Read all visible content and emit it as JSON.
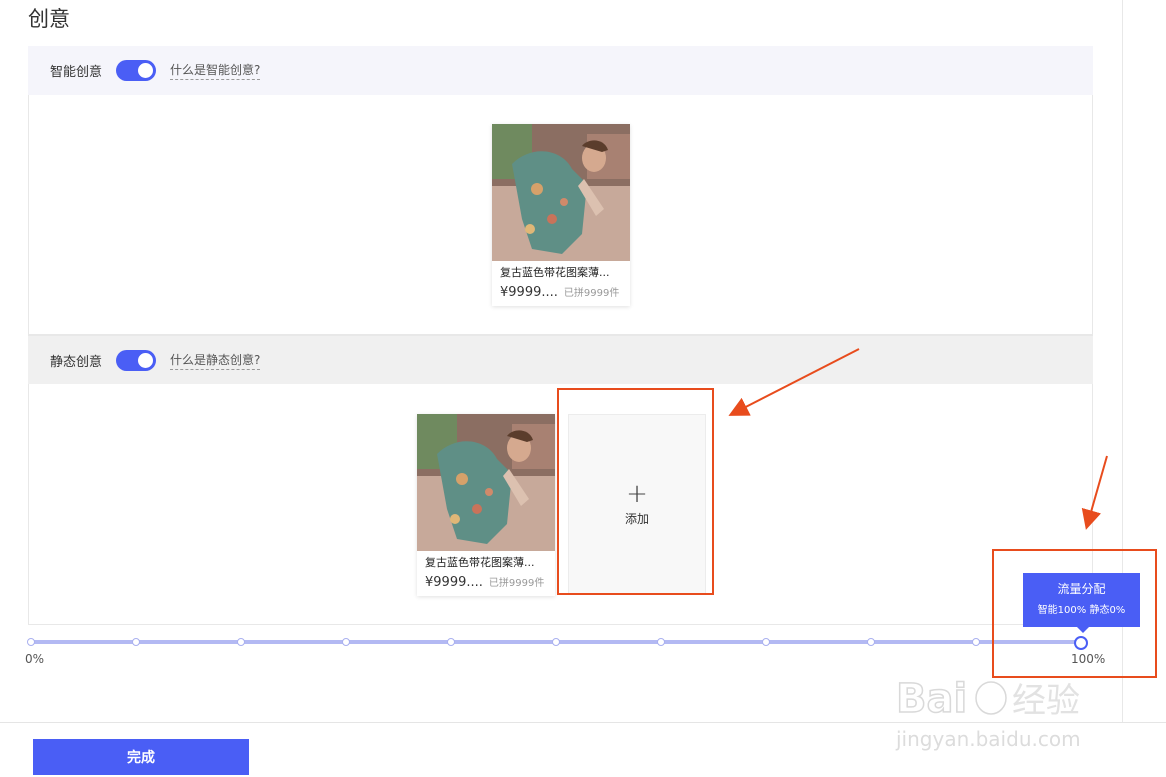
{
  "page": {
    "title": "创意"
  },
  "smart_section": {
    "label": "智能创意",
    "toggle_on": true,
    "help_link": "什么是智能创意?",
    "product": {
      "name": "复古蓝色带花图案薄...",
      "price": "¥9999....",
      "sold": "已拼9999件"
    }
  },
  "static_section": {
    "label": "静态创意",
    "toggle_on": true,
    "help_link": "什么是静态创意?",
    "product": {
      "name": "复古蓝色带花图案薄...",
      "price": "¥9999....",
      "sold": "已拼9999件"
    },
    "add_label": "添加",
    "add_icon": "plus-icon"
  },
  "traffic_slider": {
    "value_percent": 100,
    "min_label": "0%",
    "max_label": "100%",
    "tooltip_title": "流量分配",
    "tooltip_body": "智能100% 静态0%"
  },
  "footer": {
    "done_label": "完成"
  },
  "watermark": {
    "logo_text": "Baidu经验",
    "url_text": "jingyan.baidu.com"
  },
  "colors": {
    "accent": "#4a5ef5",
    "annotation": "#e84c1d",
    "slider_track": "#b3b9f3"
  }
}
